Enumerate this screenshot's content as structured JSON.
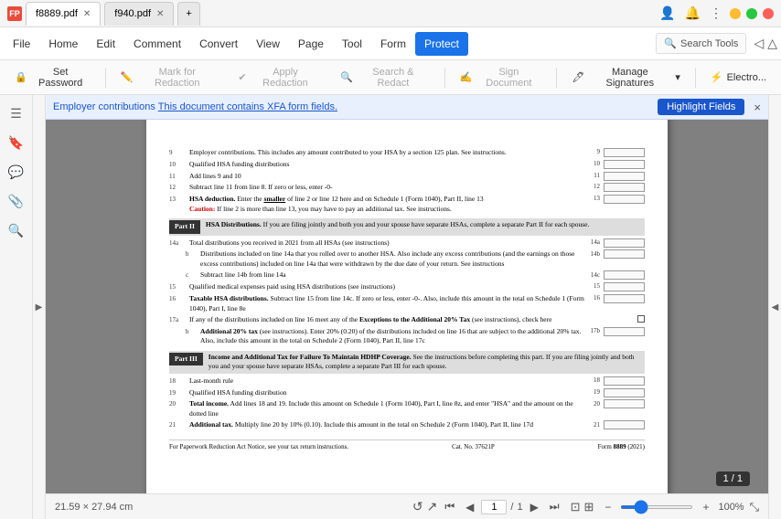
{
  "titlebar": {
    "app_label": "FP",
    "tab1_name": "f8889.pdf",
    "tab2_name": "f940.pdf",
    "new_tab": "+"
  },
  "menu": {
    "items": [
      "File",
      "Home",
      "Edit",
      "Comment",
      "Convert",
      "View",
      "Page",
      "Tool",
      "Form",
      "Protect"
    ],
    "active": "Protect",
    "search_tools": "Search Tools"
  },
  "toolbar": {
    "set_password": "Set Password",
    "mark_redaction": "Mark for Redaction",
    "apply_redaction": "Apply Redaction",
    "search_redact": "Search & Redact",
    "sign_document": "Sign Document",
    "manage_signatures": "Manage Signatures",
    "electronic": "Electro..."
  },
  "xfa_bar": {
    "message": "This document contains XFA form fields.",
    "button": "Highlight Fields",
    "close": "×"
  },
  "sidebar": {
    "icons": [
      "☰",
      "🔖",
      "💬",
      "📎",
      "🔍"
    ]
  },
  "pdf": {
    "filename": "f8889.pdf",
    "lines": [
      {
        "num": "9",
        "text": "Employer contributions. This includes any amount contributed to your HSA by a section 125 plan...",
        "field_num": "9",
        "has_field": true
      },
      {
        "num": "10",
        "text": "Qualified HSA funding distributions",
        "field_num": "10",
        "has_field": true
      },
      {
        "num": "11",
        "text": "Add lines 9 and 10",
        "field_num": "11",
        "has_field": true
      },
      {
        "num": "12",
        "text": "Subtract line 11 from line 8. If zero or less, enter -0-",
        "field_num": "12",
        "has_field": true
      },
      {
        "num": "13",
        "text": "HSA deduction. Enter the smaller of line 2 or line 12 here and on Schedule 1 (Form 1040), Part II, line 13",
        "field_num": "13",
        "has_field": true
      }
    ],
    "part2_header": "Part II",
    "part2_title": "HSA Distributions.",
    "part2_text": "If you are filing jointly and both you and your spouse have separate HSAs, complete a separate Part II for each spouse.",
    "part3_header": "Part III",
    "part3_title": "Income and Additional Tax for Failure To Maintain HDHP Coverage.",
    "part3_text": "See the instructions before completing this part. If you are filing jointly and both you and your spouse have separate HSAs, complete a separate Part III for each spouse.",
    "form_number": "Form 8889 (2021)",
    "cat_number": "Cat. No. 37621P",
    "footer_text": "For Paperwork Reduction Act Notice, see your tax return instructions.",
    "page_size": "21.59 × 27.94 cm"
  },
  "bottom": {
    "page_size": "21.59 × 27.94 cm",
    "current_page": "1",
    "total_pages": "1",
    "page_of": "1 / 1",
    "zoom": "100%",
    "page_badge": "1 / 1"
  }
}
